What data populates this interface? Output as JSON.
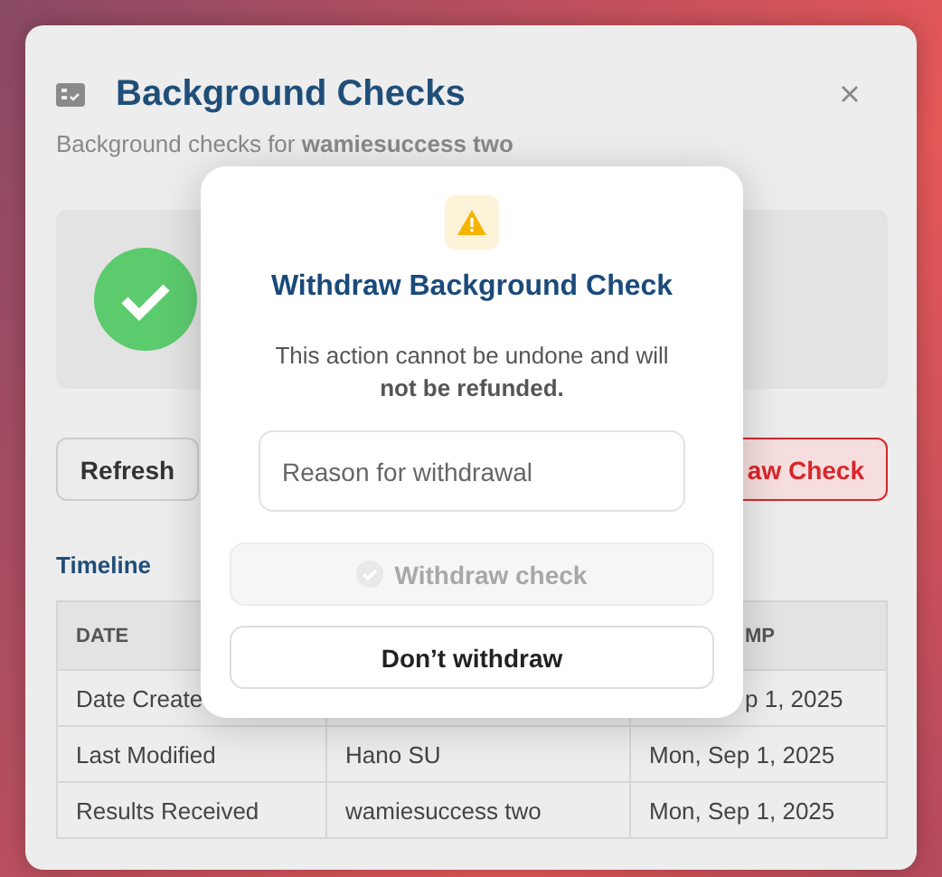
{
  "panel": {
    "title": "Background Checks",
    "subtitle": "Background checks for **wamiesuccess two**",
    "complete": true
  },
  "actions": [
    {
      "label": "Refresh",
      "kind": "neutral"
    },
    {
      "label": "aw Check",
      "kind": "danger"
    }
  ],
  "timeline": {
    "title": "Timeline",
    "columns": [
      "DATE",
      "",
      "MP"
    ],
    "rows": [
      [
        "Date Create",
        "",
        "p 1, 2025"
      ],
      [
        "Last Modified",
        "Hano SU",
        "Mon, Sep 1, 2025"
      ],
      [
        "Results Received",
        "wamiesuccess two",
        "Mon, Sep 1, 2025"
      ]
    ]
  },
  "dialog": {
    "title": "Withdraw Background Check",
    "message": "This action cannot be undone and will **not be refunded.**",
    "reason": {
      "placeholder": "Reason for withdrawal"
    },
    "buttons": [
      {
        "label": "Withdraw check",
        "kind": "confirm",
        "disabled": true
      },
      {
        "label": "Don’t withdraw",
        "kind": "cancel",
        "disabled": false
      }
    ]
  }
}
